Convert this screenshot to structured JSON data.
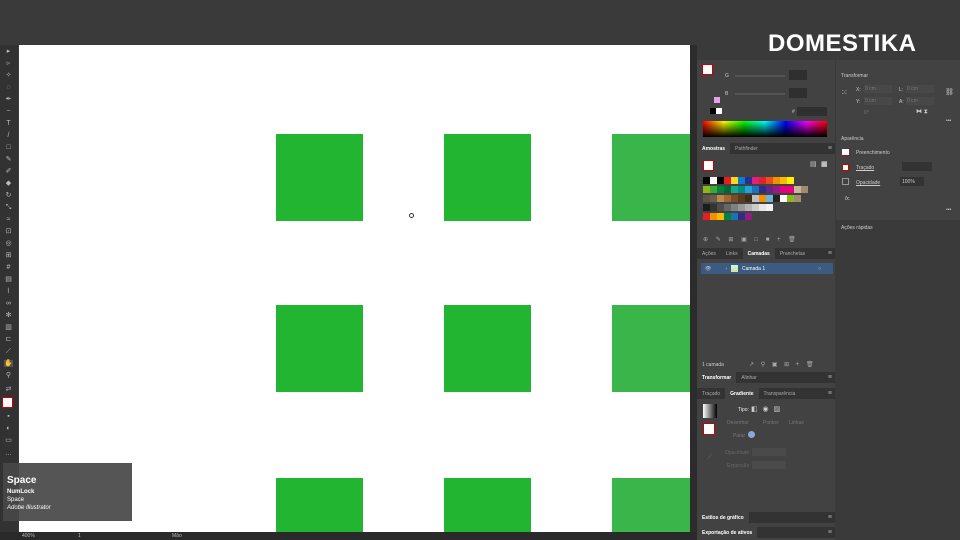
{
  "logo": "DOMESTIKA",
  "tooltip": {
    "key": "Space",
    "line1": "NumLock",
    "line2": "Space",
    "app": "Adobe Illustrator"
  },
  "status": {
    "zoom": "400%",
    "artboard": "1",
    "tool": "Mão"
  },
  "color_panel": {
    "g_label": "G",
    "b_label": "B",
    "hex_label": "#"
  },
  "swatches_panel": {
    "tabs": [
      "Amostras",
      "Pathfinder"
    ],
    "rows": [
      [
        "#000",
        "#fff",
        "#000",
        "#e31e24",
        "#f9d71c",
        "#0b7bd0",
        "#2a2f8f",
        "#e2217e",
        "#d72729",
        "#e94e1b",
        "#f39200",
        "#fbb900",
        "#fff200"
      ],
      [
        "#8cb81c",
        "#3aaa35",
        "#00843d",
        "#006633",
        "#1aa58b",
        "#008b8b",
        "#2a9fd6",
        "#1d71b8",
        "#2d2e83",
        "#662483",
        "#951b81",
        "#e6007e",
        "#e6007e",
        "#c8b79b",
        "#a08c6e"
      ],
      [
        "#5f5447",
        "#6d5d4b",
        "#b58b4b",
        "#9c6a2f",
        "#7a4e23",
        "#5c3a1b",
        "#3e2b18",
        "#c0c0c0",
        "#f39200",
        "#6ab4e0",
        "#222",
        "#fff",
        "#8cb81c",
        "#a08c6e"
      ],
      [
        "#1b1b1b",
        "#333",
        "#4d4d4d",
        "#666",
        "#808080",
        "#999",
        "#b3b3b3",
        "#ccc",
        "#e6e6e6",
        "#f2f2f2"
      ],
      [
        "#e31e24",
        "#f39200",
        "#fbb900",
        "#00843d",
        "#1d71b8",
        "#2d2e83",
        "#951b81"
      ]
    ]
  },
  "layers_panel": {
    "tabs": [
      "Ações",
      "Links",
      "Camadas",
      "Pranchetas"
    ],
    "layer_name": "Camada 1",
    "count": "1 camada"
  },
  "transform_tabs": [
    "Transformar",
    "Alinhar"
  ],
  "gradient_panel": {
    "tabs": [
      "Traçado",
      "Gradiente",
      "Transparência"
    ],
    "type_label": "Tipo:",
    "draw_label": "Desenhar",
    "points_label": "Pontos",
    "lines_label": "Linhas",
    "reverse_label": "Parar",
    "opacity_label": "Opacidade",
    "spread_label": "Expansão"
  },
  "graphic_styles": "Estilos de gráfico",
  "asset_export": "Exportação de ativos",
  "properties": {
    "transform_title": "Transformar",
    "x_label": "X:",
    "y_label": "Y:",
    "w_label": "L:",
    "h_label": "A:",
    "x_val": "0 cm",
    "y_val": "0 cm",
    "w_val": "0 cm",
    "h_val": "0 cm",
    "angle": "0°",
    "appearance_title": "Aparência",
    "fill_label": "Preenchimento",
    "stroke_label": "Traçado",
    "opacity_label": "Opacidade",
    "opacity_val": "100%",
    "fx_label": "fx.",
    "quick_actions": "Ações rápidas"
  }
}
